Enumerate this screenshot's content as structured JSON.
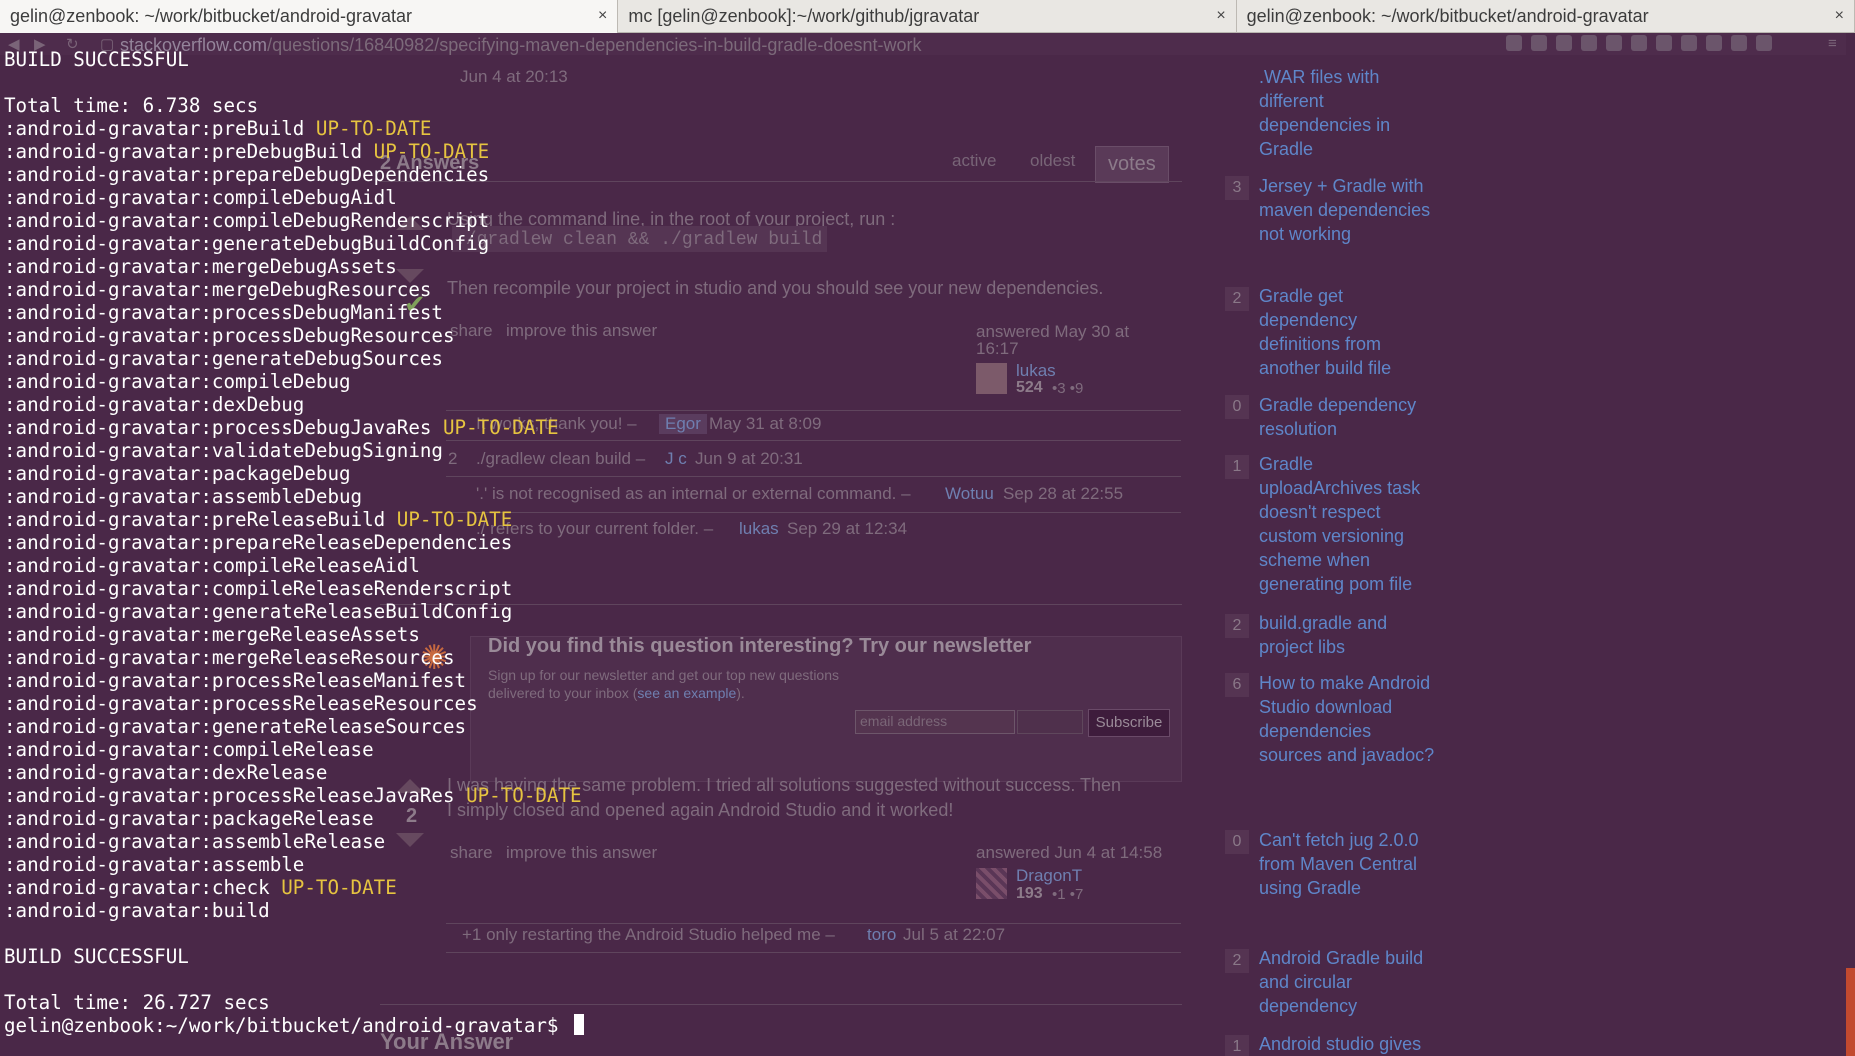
{
  "tabs": [
    {
      "label": "gelin@zenbook: ~/work/bitbucket/android-gravatar",
      "close": "×",
      "active": true
    },
    {
      "label": "mc [gelin@zenbook]:~/work/github/jgravatar",
      "close": "×",
      "active": false
    },
    {
      "label": "gelin@zenbook: ~/work/bitbucket/android-gravatar",
      "close": "×",
      "active": false
    }
  ],
  "browser": {
    "url_host": "stackoverflow.com",
    "url_path": "/questions/16840982/specifying-maven-dependencies-in-build-gradle-doesnt-work"
  },
  "answers_section": {
    "date_top": "Jun 4 at 20:13",
    "answers_count": "2 Answers",
    "sort_tabs": [
      "active",
      "oldest",
      "votes"
    ]
  },
  "answer1": {
    "text_line1": "Using the command line, in the root of your project, run :",
    "code": "./gradlew clean && ./gradlew build",
    "text_line2": "Then recompile your project in studio and you should see your new dependencies.",
    "share": "share",
    "improve": "improve this answer",
    "answered": "answered May 30 at",
    "answered_time": "16:17",
    "user": "lukas",
    "rep": "524",
    "badges": "•3 •9",
    "comments": [
      {
        "text": "It works, thank you! –",
        "user": "Egor",
        "date": "May 31 at 8:09",
        "votes": ""
      },
      {
        "text": "./gradlew clean build –",
        "user": "J c",
        "date": "Jun 9 at 20:31",
        "votes": "2"
      },
      {
        "text": "'.' is not recognised as an internal or external command. –",
        "user": "Wotuu",
        "date": "Sep 28 at 22:55",
        "votes": ""
      },
      {
        "text": "./ refers to your current folder. –",
        "user": "lukas",
        "date": "Sep 29 at 12:34",
        "votes": ""
      }
    ]
  },
  "newsletter": {
    "title": "Did you find this question interesting? Try our newsletter",
    "desc1": "Sign up for our newsletter and get our top new questions",
    "desc2": "delivered to your inbox (",
    "link": "see an example",
    "desc3": ").",
    "email_placeholder": "email address",
    "subscribe": "Subscribe"
  },
  "answer2": {
    "text_line1": "I was having the same problem. I tried all solutions suggested without success. Then",
    "text_line2": "I simply closed and opened again Android Studio and it worked!",
    "share": "share",
    "improve": "improve this answer",
    "answered": "answered Jun 4 at 14:58",
    "user": "DragonT",
    "rep": "193",
    "badges": "•1 •7",
    "votes": "2",
    "comment": {
      "text": "+1 only restarting the Android Studio helped me –",
      "user": "toro",
      "date": "Jul 5 at 22:07"
    }
  },
  "your_answer": "Your Answer",
  "related": [
    {
      "count": "",
      "title": ".WAR files with different dependencies in Gradle"
    },
    {
      "count": "3",
      "title": "Jersey + Gradle with maven dependencies not working"
    },
    {
      "count": "2",
      "title": "Gradle get dependency definitions from another build file"
    },
    {
      "count": "0",
      "title": "Gradle dependency resolution"
    },
    {
      "count": "1",
      "title": "Gradle uploadArchives task doesn't respect custom versioning scheme when generating pom file"
    },
    {
      "count": "2",
      "title": "build.gradle and project libs"
    },
    {
      "count": "6",
      "title": "How to make Android Studio download dependencies sources and javadoc?"
    },
    {
      "count": "0",
      "title": "Can't fetch jug 2.0.0 from Maven Central using Gradle"
    },
    {
      "count": "2",
      "title": "Android Gradle build and circular dependency"
    },
    {
      "count": "1",
      "title": "Android studio gives error when i add"
    }
  ],
  "terminal": {
    "lines": [
      {
        "text": "BUILD SUCCESSFUL",
        "status": ""
      },
      {
        "text": "",
        "status": ""
      },
      {
        "text": "Total time: 6.738 secs",
        "status": ""
      },
      {
        "text": ":android-gravatar:preBuild ",
        "status": "UP-TO-DATE"
      },
      {
        "text": ":android-gravatar:preDebugBuild ",
        "status": "UP-TO-DATE"
      },
      {
        "text": ":android-gravatar:prepareDebugDependencies",
        "status": ""
      },
      {
        "text": ":android-gravatar:compileDebugAidl",
        "status": ""
      },
      {
        "text": ":android-gravatar:compileDebugRenderscript",
        "status": ""
      },
      {
        "text": ":android-gravatar:generateDebugBuildConfig",
        "status": ""
      },
      {
        "text": ":android-gravatar:mergeDebugAssets",
        "status": ""
      },
      {
        "text": ":android-gravatar:mergeDebugResources",
        "status": ""
      },
      {
        "text": ":android-gravatar:processDebugManifest",
        "status": ""
      },
      {
        "text": ":android-gravatar:processDebugResources",
        "status": ""
      },
      {
        "text": ":android-gravatar:generateDebugSources",
        "status": ""
      },
      {
        "text": ":android-gravatar:compileDebug",
        "status": ""
      },
      {
        "text": ":android-gravatar:dexDebug",
        "status": ""
      },
      {
        "text": ":android-gravatar:processDebugJavaRes ",
        "status": "UP-TO-DATE"
      },
      {
        "text": ":android-gravatar:validateDebugSigning",
        "status": ""
      },
      {
        "text": ":android-gravatar:packageDebug",
        "status": ""
      },
      {
        "text": ":android-gravatar:assembleDebug",
        "status": ""
      },
      {
        "text": ":android-gravatar:preReleaseBuild ",
        "status": "UP-TO-DATE"
      },
      {
        "text": ":android-gravatar:prepareReleaseDependencies",
        "status": ""
      },
      {
        "text": ":android-gravatar:compileReleaseAidl",
        "status": ""
      },
      {
        "text": ":android-gravatar:compileReleaseRenderscript",
        "status": ""
      },
      {
        "text": ":android-gravatar:generateReleaseBuildConfig",
        "status": ""
      },
      {
        "text": ":android-gravatar:mergeReleaseAssets",
        "status": ""
      },
      {
        "text": ":android-gravatar:mergeReleaseResources",
        "status": ""
      },
      {
        "text": ":android-gravatar:processReleaseManifest",
        "status": ""
      },
      {
        "text": ":android-gravatar:processReleaseResources",
        "status": ""
      },
      {
        "text": ":android-gravatar:generateReleaseSources",
        "status": ""
      },
      {
        "text": ":android-gravatar:compileRelease",
        "status": ""
      },
      {
        "text": ":android-gravatar:dexRelease",
        "status": ""
      },
      {
        "text": ":android-gravatar:processReleaseJavaRes ",
        "status": "UP-TO-DATE"
      },
      {
        "text": ":android-gravatar:packageRelease",
        "status": ""
      },
      {
        "text": ":android-gravatar:assembleRelease",
        "status": ""
      },
      {
        "text": ":android-gravatar:assemble",
        "status": ""
      },
      {
        "text": ":android-gravatar:check ",
        "status": "UP-TO-DATE"
      },
      {
        "text": ":android-gravatar:build",
        "status": ""
      },
      {
        "text": "",
        "status": ""
      },
      {
        "text": "BUILD SUCCESSFUL",
        "status": ""
      },
      {
        "text": "",
        "status": ""
      },
      {
        "text": "Total time: 26.727 secs",
        "status": ""
      }
    ],
    "prompt": "gelin@zenbook:~/work/bitbucket/android-gravatar$ "
  },
  "colors": {
    "terminal_bg": "#4a2848",
    "terminal_text": "#ffffff",
    "uptodate": "#e6c440",
    "link": "#5f86c9"
  }
}
